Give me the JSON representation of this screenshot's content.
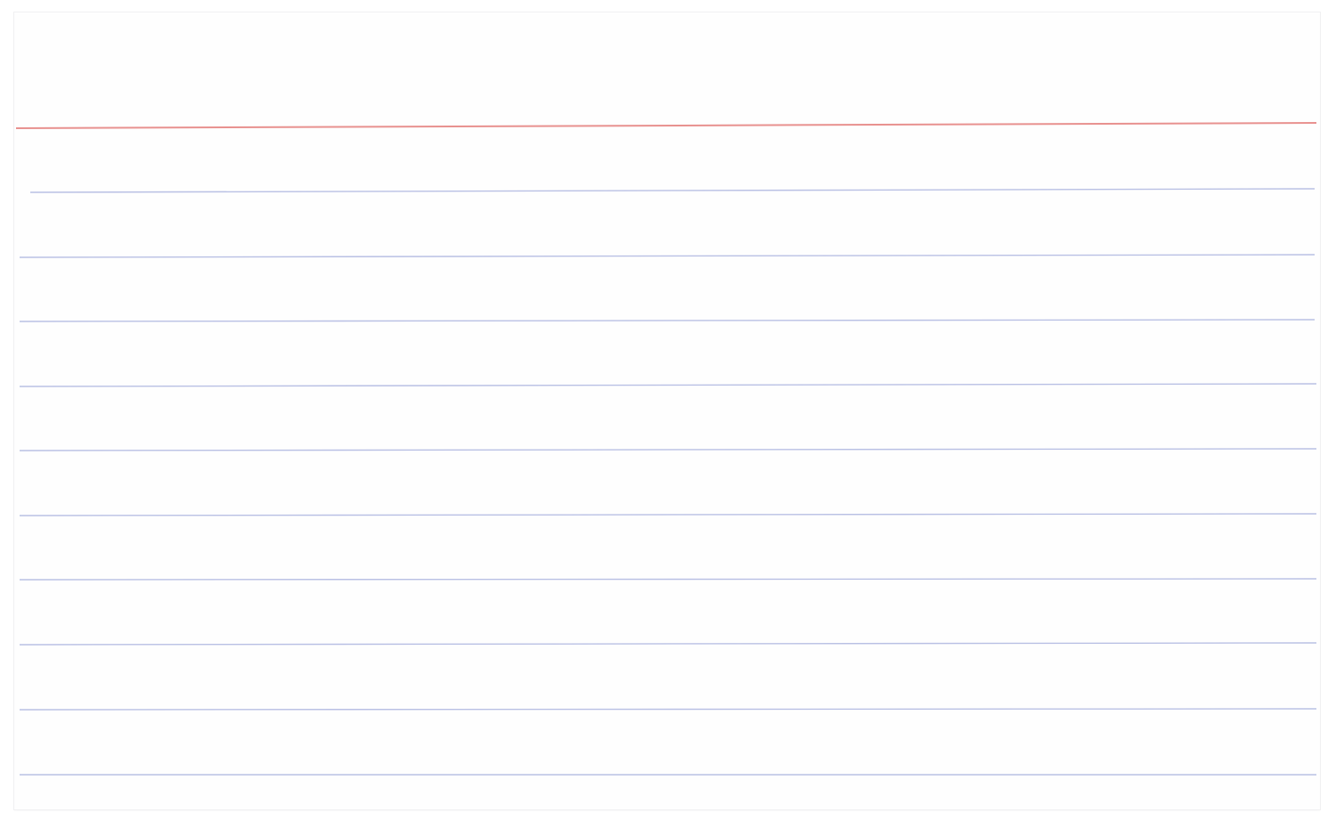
{
  "card": {
    "background": "#fefefe",
    "header_rule_color": "#e8918f",
    "line_color": "#b9c0e4",
    "ruled_line_count": 10
  }
}
